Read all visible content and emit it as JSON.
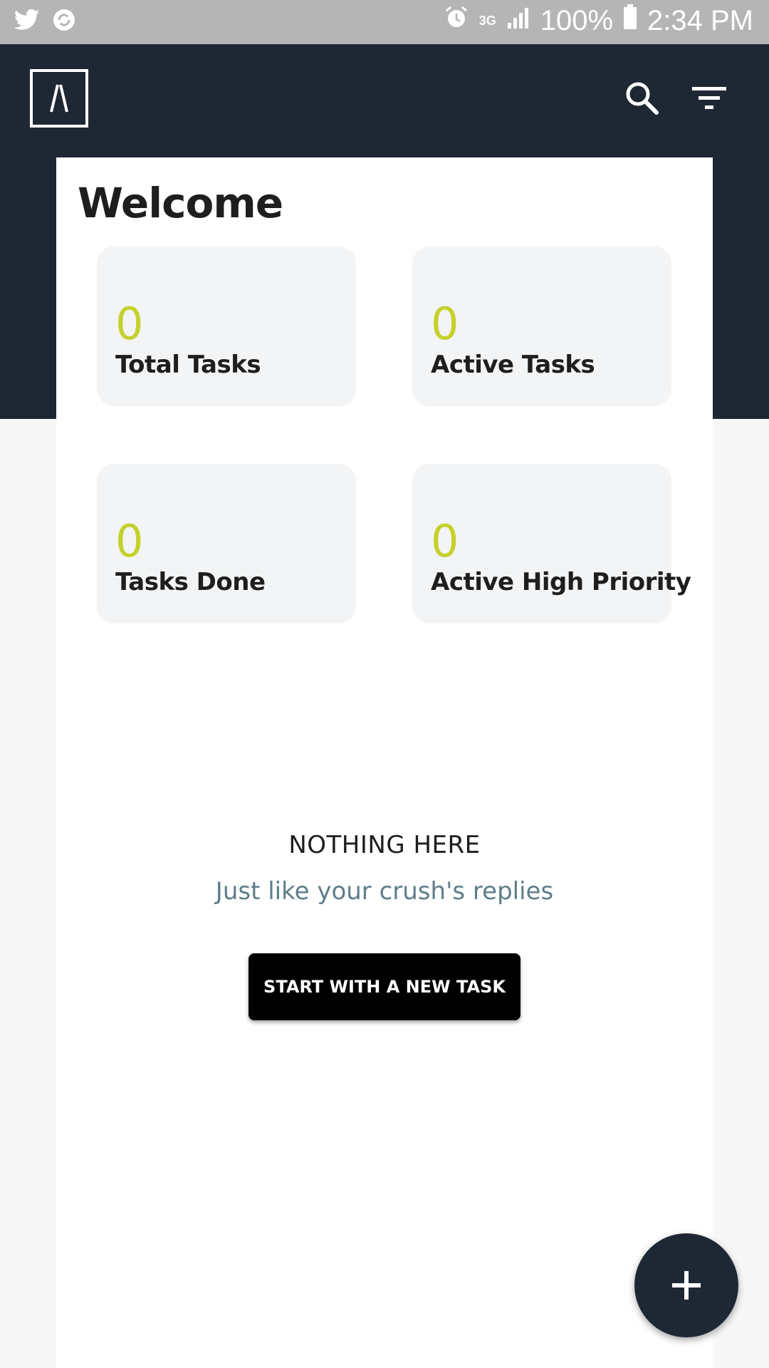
{
  "status_bar": {
    "left_icons": [
      "twitter-icon",
      "sync-app-icon"
    ],
    "network": "3G",
    "battery": "100%",
    "time": "2:34 PM"
  },
  "header": {
    "logo_icon": "app-logo",
    "actions": [
      "search-icon",
      "filter-icon"
    ]
  },
  "welcome": {
    "title": "Welcome"
  },
  "stats": [
    {
      "value": "0",
      "label": "Total Tasks"
    },
    {
      "value": "0",
      "label": "Active Tasks"
    },
    {
      "value": "0",
      "label": "Tasks Done"
    },
    {
      "value": "0",
      "label": "Active High Priority"
    }
  ],
  "empty_state": {
    "title": "NOTHING HERE",
    "subtitle": "Just like your crush's replies",
    "button_label": "START WITH A NEW TASK"
  },
  "fab": {
    "icon": "plus-icon"
  },
  "colors": {
    "header_bg": "#1e2834",
    "accent": "#c4d12a",
    "subtitle": "#5f7d8a",
    "card_bg": "#ffffff",
    "stat_bg": "#f3f4f5"
  }
}
